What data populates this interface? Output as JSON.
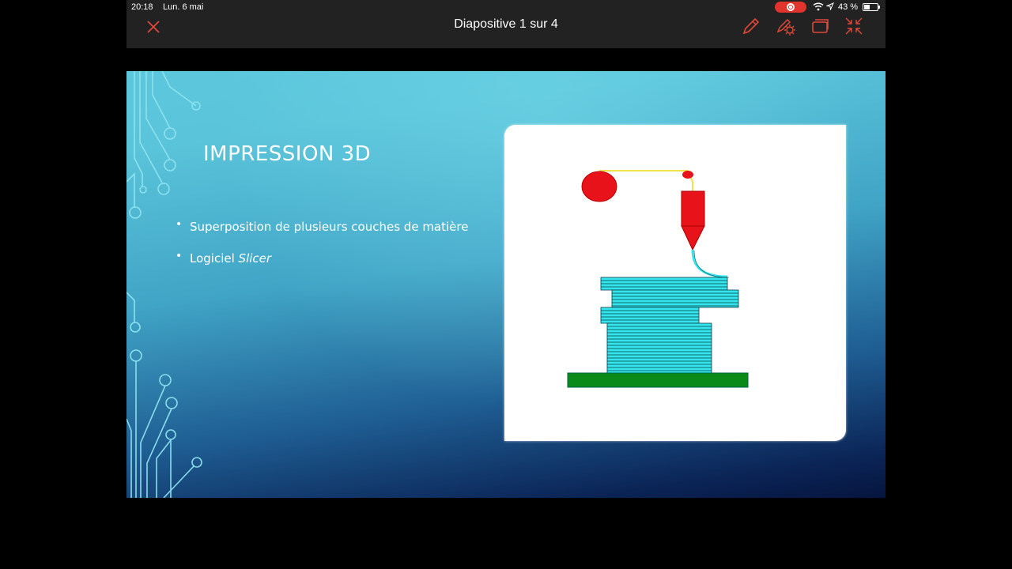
{
  "status_bar": {
    "time": "20:18",
    "date": "Lun. 6 mai",
    "battery_percent": "43 %",
    "battery_level": 0.43,
    "icons": [
      "screen-record-icon",
      "wifi-icon",
      "location-arrow-icon",
      "battery-icon"
    ]
  },
  "toolbar": {
    "title": "Diapositive 1 sur 4",
    "accent_color": "#e0483a",
    "icons": [
      "close-icon",
      "pen-icon",
      "settings-pen-icon",
      "slides-icon",
      "collapse-icon"
    ]
  },
  "slide": {
    "title": "IMPRESSION 3D",
    "bullets": [
      {
        "text": "Superposition de plusieurs couches de matière"
      },
      {
        "prefix": "Logiciel ",
        "emphasis": "Slicer"
      }
    ],
    "image": {
      "description_icon": "3d-printer-illustration",
      "colors": {
        "filament_spool": "#e8131a",
        "extruder": "#e8131a",
        "layers": "#33e6ee",
        "build_plate": "#0a8a18",
        "filament_line": "#f2e24a"
      }
    }
  }
}
